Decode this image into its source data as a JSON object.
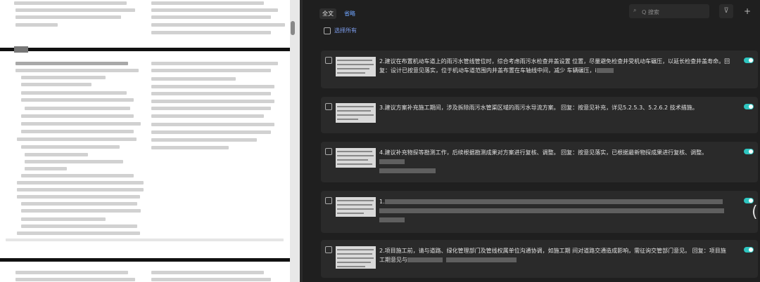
{
  "tabs": [
    {
      "label": "全文",
      "active": true
    },
    {
      "label": "省略",
      "active": false
    }
  ],
  "search": {
    "placeholder": "Q 搜索",
    "icon": "search-icon"
  },
  "toolbar": {
    "filter_icon": "filter-icon",
    "add_icon": "plus-icon"
  },
  "select_all": {
    "label": "选择所有"
  },
  "accent_color": "#2ec5c0",
  "link_color": "#6fa4ff",
  "comments": [
    {
      "text": "2.建议在布置机动车道上的雨污水管线管位时，综合考虑雨污水检查井盖设置 位置，尽量避免检查井受机动车碾压，以延长检查井盖寿命。回复：设计已按意见落实，位于机动车道范围内井盖布置在车轴线中间，减少 车辆碾压，i",
      "enabled": true
    },
    {
      "text": "3.建议方案补充施工期间，涉及拆除雨污水管渠区域的雨污水导流方案。 回复：按意见补充，详见5.2.5.3、5.2.6.2 技术措施。",
      "enabled": true
    },
    {
      "text": "4.建议补充物探等勘测工作，后续根据勘测成果对方案进行复核、调整。 回复：按意见落实，已根据最新物探成果进行复核、调整。",
      "enabled": true
    },
    {
      "text": "1.",
      "enabled": true
    },
    {
      "text": "2.项目施工前，请与道路、绿化管理部门及管线权属单位沟通协调，如施工期 间对道路交通造成影响，需征询交管部门意见。 回复：项目施工期意见与",
      "enabled": true
    }
  ],
  "edge_glyph": "("
}
